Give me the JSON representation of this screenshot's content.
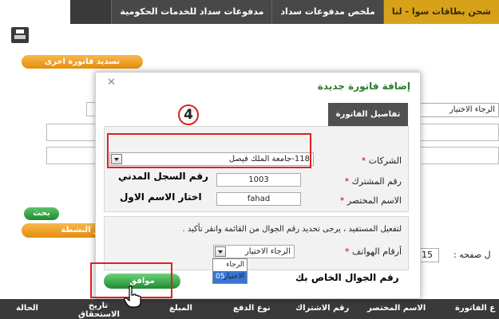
{
  "tabs": [
    "شحن بطاقات سوا - لنا",
    "ملخص مدفوعات سداد",
    "مدفوعات سداد للخدمات الحكومية"
  ],
  "buttons": {
    "pay_other": "تسديد فاتورة اخرى",
    "search": "بحث",
    "activity": "ير النشطة"
  },
  "background": {
    "select_value": "الرجاء الاختيار",
    "per_page_label": "ل صفحه :",
    "per_page_value": "15"
  },
  "table_headers": [
    "ع الفاتورة",
    "الاسم المختصر",
    "رقم الاشتراك",
    "نوع الدفع",
    "المبلغ",
    "تاريخ الاستحقاق",
    "الحالة"
  ],
  "modal": {
    "title": "إضافة فاتورة جديدة",
    "tab": "تفاصيل الفاتورة",
    "companies_label": "الشركات",
    "companies_value": "118-جامعة الملك فيصل",
    "subscriber_label": "رقم المشترك",
    "subscriber_value": "1003",
    "short_name_label": "الاسم المختصر",
    "short_name_value": "fahad",
    "notice": "لتفعيل المستفيد ، يرجى تحديد رقم الجوال من القائمة وانقر تأكيد .",
    "phones_label": "أرقام الهواتف",
    "phones_value": "الرجاء الاختيار",
    "phone_options": [
      "الرجاء الاختيار",
      "05"
    ],
    "ok": "موافق",
    "required_mark": "*"
  },
  "annotations": {
    "step": "4",
    "civil_id": "رقم السجل المدني",
    "first_name": "اختار الاسم الاول",
    "mobile": "رقم الجوال الخاص بك"
  }
}
